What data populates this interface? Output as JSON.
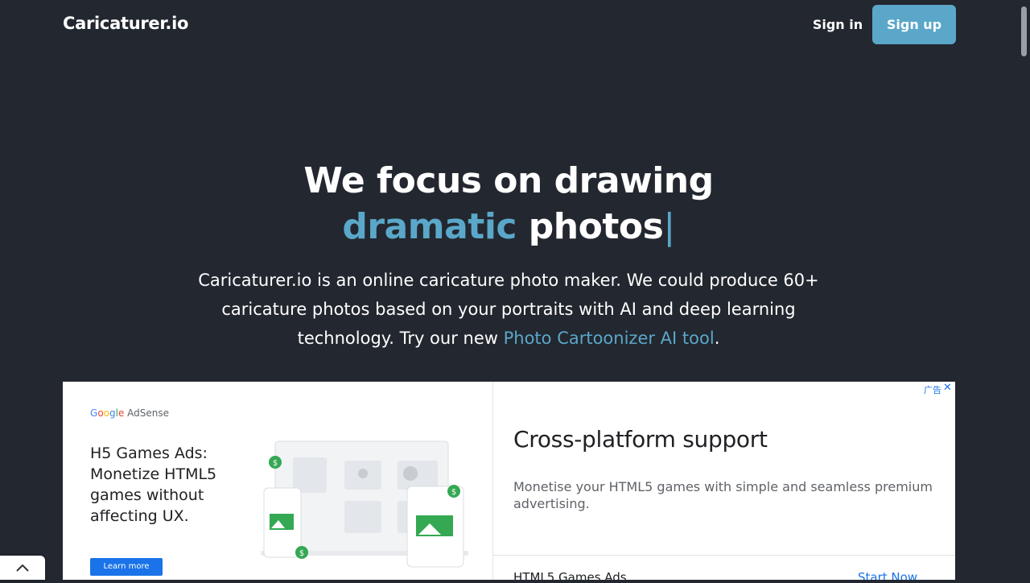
{
  "header": {
    "logo": "Caricaturer.io",
    "signin_label": "Sign in",
    "signup_label": "Sign up"
  },
  "hero": {
    "title_line1": "We focus on drawing",
    "title_accent": "dramatic",
    "title_rest": " photos",
    "title_cursor": "|",
    "desc_before": "Caricaturer.io is an online caricature photo maker. We could produce 60+ caricature photos based on your portraits with AI and deep learning technology. Try our new ",
    "desc_link": "Photo Cartoonizer AI tool",
    "desc_after": "."
  },
  "ad": {
    "brand_google": [
      "G",
      "o",
      "o",
      "g",
      "l",
      "e"
    ],
    "brand_product": " AdSense",
    "headline_bold": "H5 Games Ads:",
    "headline_rest": "Monetize HTML5 games without affecting UX.",
    "learn_more_label": "Learn more",
    "title": "Cross-platform support",
    "body": "Monetise your HTML5 games with simple and seamless premium advertising.",
    "cutoff_text": "HTML5 Games Ads",
    "cutoff_link": "Start Now",
    "choice_label": "广告",
    "close_label": "✕"
  },
  "colors": {
    "background": "#23272f",
    "accent": "#5aa7c9",
    "white": "#ffffff"
  },
  "icons": {
    "back_to_top": "chevron-up-icon",
    "ad_close": "close-icon"
  }
}
